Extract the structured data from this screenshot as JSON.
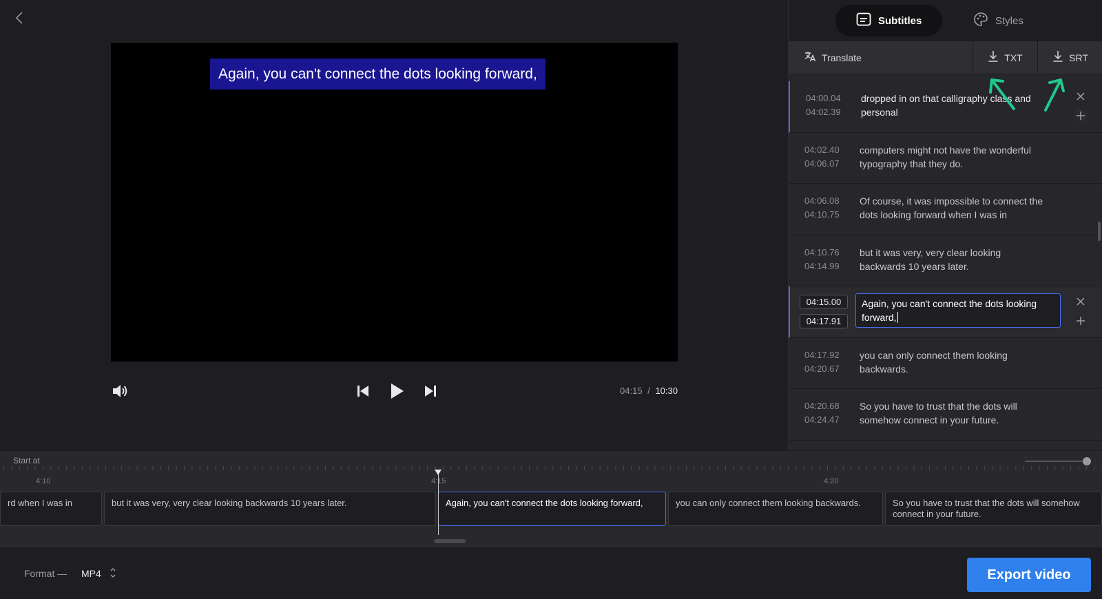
{
  "video": {
    "subtitle_overlay": "Again, you can't connect the dots looking forward,",
    "current_time": "04:15",
    "time_separator": "/",
    "total_time": "10:30"
  },
  "panel": {
    "tabs": [
      {
        "label": "Subtitles",
        "icon": "subtitles-icon",
        "active": true
      },
      {
        "label": "Styles",
        "icon": "palette-icon",
        "active": false
      }
    ],
    "toolbar": {
      "translate_label": "Translate",
      "txt_label": "TXT",
      "srt_label": "SRT"
    },
    "rows": [
      {
        "start": "04:00.04",
        "end": "04:02.39",
        "text": "dropped in on that calligraphy class and personal"
      },
      {
        "start": "04:02.40",
        "end": "04:06.07",
        "text": "computers might not have the wonderful typography that they do."
      },
      {
        "start": "04:06.08",
        "end": "04:10.75",
        "text": "Of course, it was impossible to connect the dots looking forward when I was in"
      },
      {
        "start": "04:10.76",
        "end": "04:14.99",
        "text": "but it was very, very clear looking backwards 10 years later."
      },
      {
        "start": "04:15.00",
        "end": "04:17.91",
        "text": "Again, you can't connect the dots looking forward,"
      },
      {
        "start": "04:17.92",
        "end": "04:20.67",
        "text": "you can only connect them looking backwards."
      },
      {
        "start": "04:20.68",
        "end": "04:24.47",
        "text": "So you have to trust that the dots will somehow connect in your future."
      }
    ]
  },
  "timeline": {
    "start_at_label": "Start at",
    "ticks": [
      "4:10",
      "4:15",
      "4:20"
    ],
    "clips": [
      "rd when I was in",
      "but it was very, very clear looking backwards 10 years later.",
      "Again, you can't connect the dots looking forward,",
      "you can only connect them looking backwards.",
      "So you have to trust that the dots will somehow connect in your future."
    ]
  },
  "footer": {
    "format_label": "Format —",
    "format_value": "MP4",
    "export_label": "Export video"
  },
  "colors": {
    "accent": "#2f80ed",
    "selection": "#4a6cf0",
    "subtitle_bg": "#1a1590",
    "annotation": "#1fc98a"
  }
}
